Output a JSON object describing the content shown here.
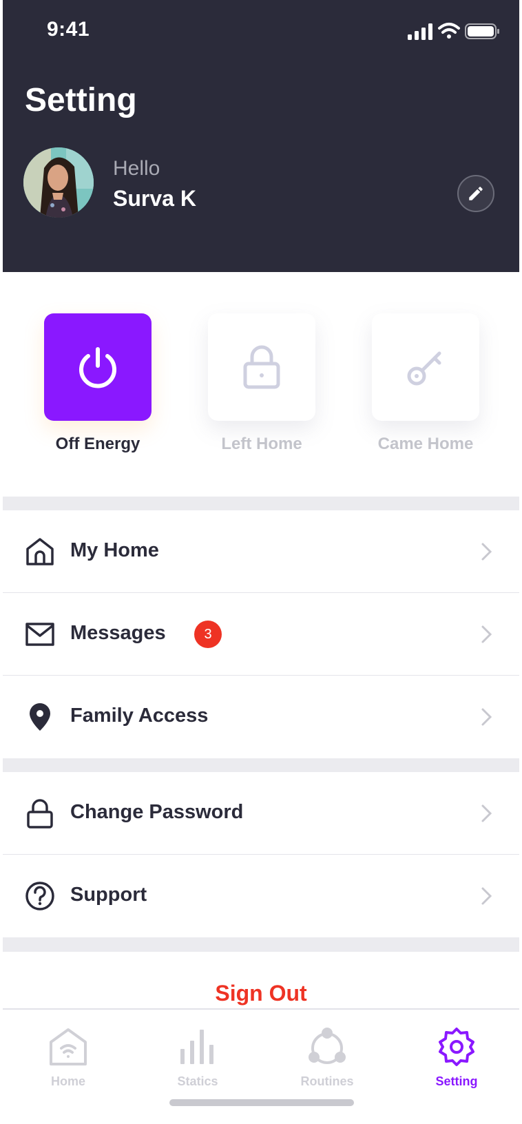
{
  "status_bar": {
    "time": "9:41"
  },
  "header": {
    "title": "Setting",
    "greeting": "Hello",
    "user_name": "Surva K"
  },
  "scenes": [
    {
      "label": "Off Energy",
      "icon": "power-icon",
      "active": true
    },
    {
      "label": "Left Home",
      "icon": "lock-icon",
      "active": false
    },
    {
      "label": "Came Home",
      "icon": "key-icon",
      "active": false
    }
  ],
  "menu": {
    "group1": [
      {
        "label": "My Home",
        "icon": "home-icon"
      },
      {
        "label": "Messages",
        "icon": "mail-icon",
        "badge": "3"
      },
      {
        "label": "Family Access",
        "icon": "location-pin-icon"
      }
    ],
    "group2": [
      {
        "label": "Change Password",
        "icon": "lock-icon"
      },
      {
        "label": "Support",
        "icon": "help-circle-icon"
      }
    ]
  },
  "sign_out": "Sign Out",
  "tabs": [
    {
      "label": "Home",
      "icon": "home-wifi-icon",
      "active": false
    },
    {
      "label": "Statics",
      "icon": "bar-chart-icon",
      "active": false
    },
    {
      "label": "Routines",
      "icon": "routines-icon",
      "active": false
    },
    {
      "label": "Setting",
      "icon": "gear-icon",
      "active": true
    }
  ],
  "colors": {
    "header_bg": "#2b2b3a",
    "accent": "#8a18ff",
    "danger": "#ee3324",
    "inactive": "#c3c4cb"
  }
}
